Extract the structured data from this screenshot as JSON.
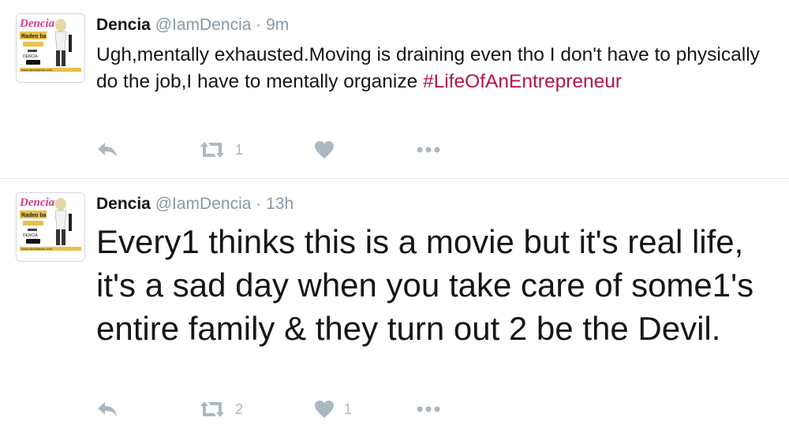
{
  "tweets": [
    {
      "name": "Dencia",
      "handle": "@IamDencia",
      "separator": " · ",
      "time": "9m",
      "text": "Ugh,mentally exhausted.Moving is draining even tho I don't have to physically do the job,I have to mentally organize ",
      "hashtag": "#LifeOfAnEntrepreneur",
      "retweets": "1",
      "likes": ""
    },
    {
      "name": "Dencia",
      "handle": "@IamDencia",
      "separator": " · ",
      "time": "13h",
      "text": "Every1 thinks this is a movie but it's real life, it's a sad day when you take care of some1's entire family & they turn out 2 be the Devil.",
      "retweets": "2",
      "likes": "1"
    }
  ],
  "avatar": {
    "logo_text": "Dencia",
    "banner_text": "Radeo ba",
    "caption": "DENCIA",
    "url": "www.denciastore.com",
    "brand_color": "#d63a8c"
  },
  "colors": {
    "icon": "#aab8c2",
    "hashtag": "#b3134f",
    "meta": "#8899a6"
  },
  "icons": [
    "reply-icon",
    "retweet-icon",
    "heart-icon",
    "more-icon"
  ]
}
